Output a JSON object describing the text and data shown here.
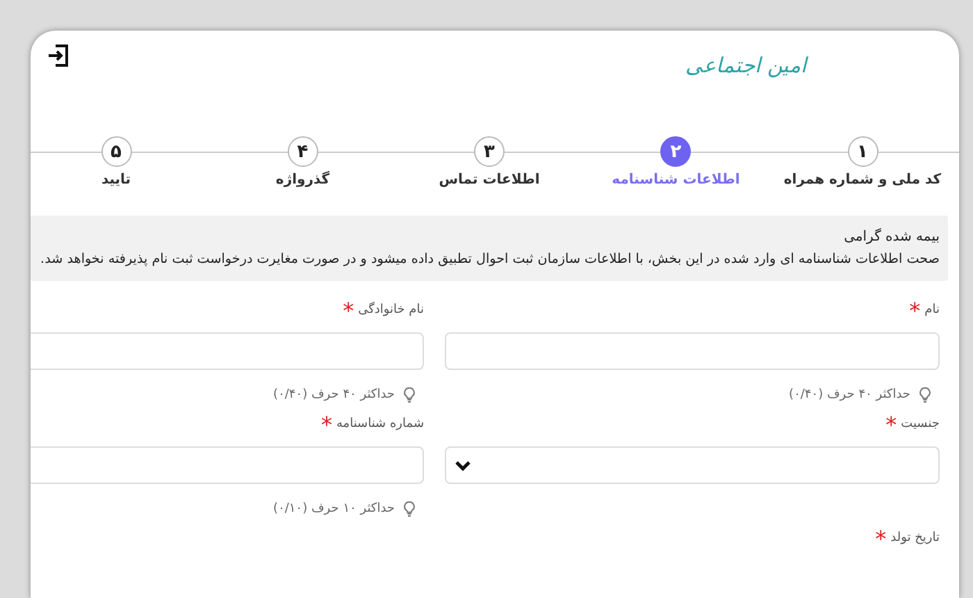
{
  "header": {
    "logo_text": "امین اجتماعی"
  },
  "steps": [
    {
      "number": "۱",
      "label": "کد ملی و شماره همراه",
      "selected": false
    },
    {
      "number": "۲",
      "label": "اطلاعات شناسنامه",
      "selected": true
    },
    {
      "number": "۳",
      "label": "اطلاعات تماس",
      "selected": false
    },
    {
      "number": "۴",
      "label": "گذرواژه",
      "selected": false
    },
    {
      "number": "۵",
      "label": "تایید",
      "selected": false
    }
  ],
  "notice": {
    "title": "بیمه شده گرامی",
    "text": "صحت اطلاعات شناسنامه ای وارد شده در این بخش، با اطلاعات سازمان ثبت احوال تطبیق داده میشود و در صورت مغایرت درخواست ثبت نام پذیرفته نخواهد شد."
  },
  "fields": [
    {
      "kind": "text",
      "label": "نام",
      "required_mark": "*",
      "hint": "حداکثر ۴۰ حرف (۰/۴۰)"
    },
    {
      "kind": "text",
      "label": "نام خانوادگی",
      "required_mark": "*",
      "hint": "حداکثر ۴۰ حرف (۰/۴۰)"
    },
    {
      "kind": "select",
      "label": "جنسیت",
      "required_mark": "*"
    },
    {
      "kind": "text",
      "label": "شماره شناسنامه",
      "required_mark": "*",
      "hint": "حداکثر ۱۰ حرف (۰/۱۰)"
    },
    {
      "kind": "label",
      "label": "تاریخ تولد",
      "required_mark": "*"
    }
  ]
}
